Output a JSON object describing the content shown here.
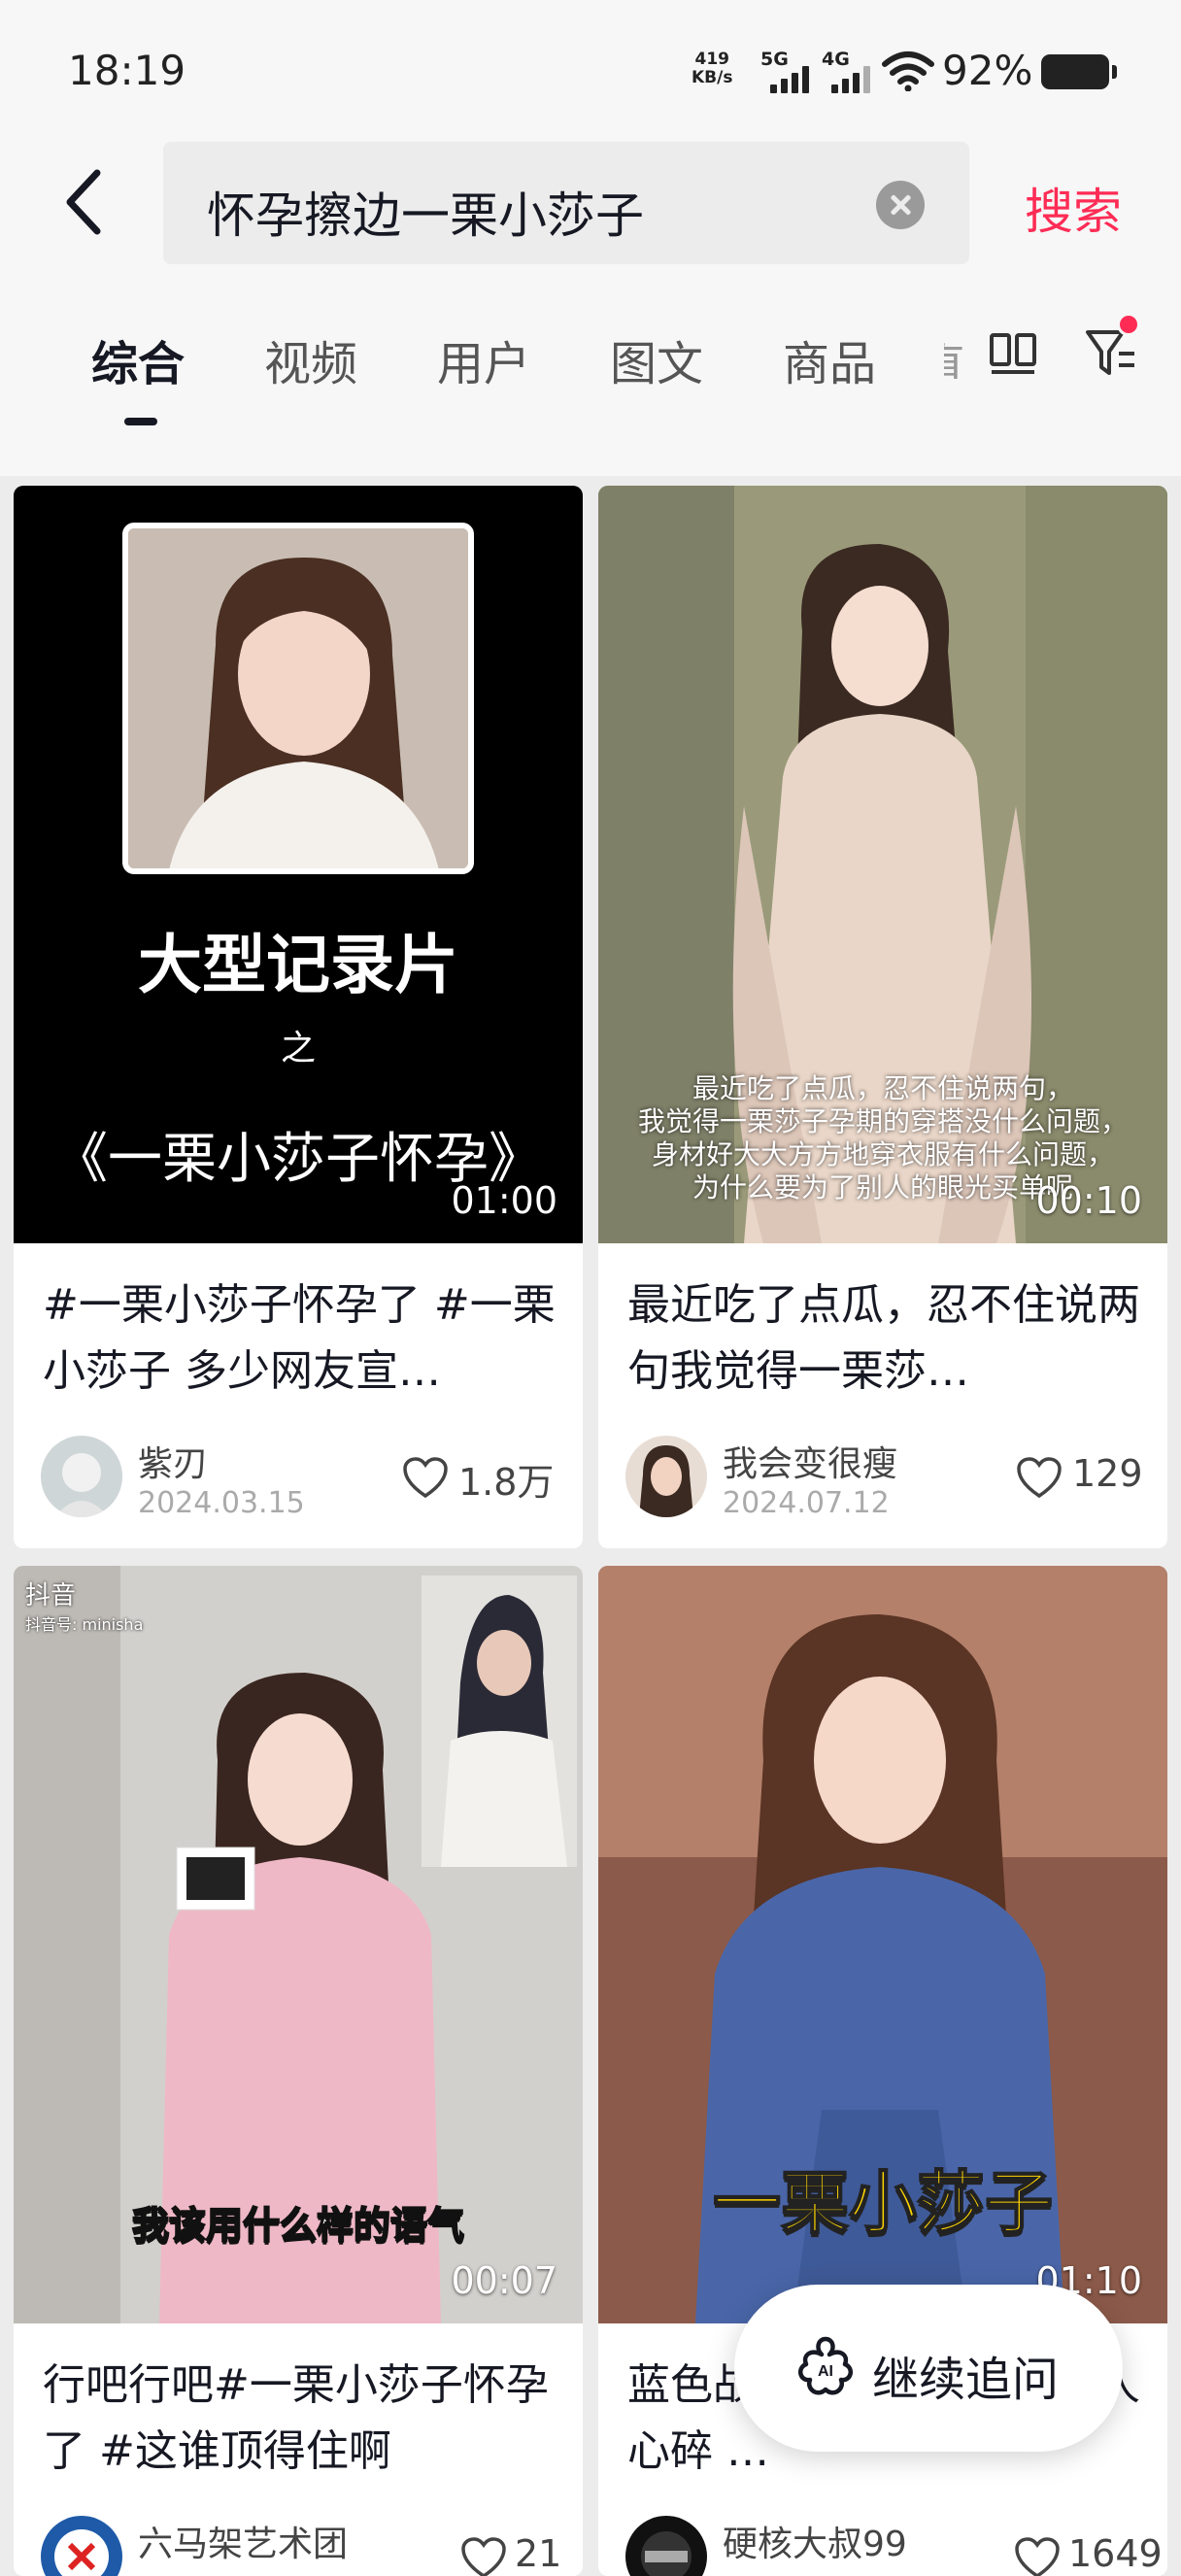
{
  "status_bar": {
    "time": "18:19",
    "net_speed_value": "419",
    "net_speed_unit": "KB/s",
    "signal1_label": "5G",
    "signal2_label": "4G",
    "battery": "92%"
  },
  "search": {
    "query": "怀孕擦边一栗小莎子",
    "button": "搜索"
  },
  "tabs": [
    {
      "label": "综合",
      "active": true
    },
    {
      "label": "视频"
    },
    {
      "label": "用户"
    },
    {
      "label": "图文"
    },
    {
      "label": "商品"
    }
  ],
  "tab_partial": "直",
  "results": [
    {
      "duration": "01:00",
      "thumb_title": "大型记录片",
      "thumb_sub": "之",
      "thumb_quote": "《一栗小莎子怀孕》",
      "title": "#一栗小莎子怀孕了 #一栗小莎子 多少网友宣…",
      "author": "紫刃",
      "date": "2024.03.15",
      "likes": "1.8万"
    },
    {
      "duration": "00:10",
      "overlay_lines": [
        "最近吃了点瓜，忍不住说两句，",
        "我觉得一栗莎子孕期的穿搭没什么问题，",
        "身材好大大方方地穿衣服有什么问题，",
        "为什么要为了别人的眼光买单呢"
      ],
      "title": "最近吃了点瓜，忍不住说两句我觉得一栗莎…",
      "author": "我会变很瘦",
      "date": "2024.07.12",
      "likes": "129"
    },
    {
      "duration": "00:07",
      "watermark": "抖音",
      "watermark_id": "抖音号: minisha",
      "caption": "我该用什么样的语气",
      "title": "行吧行吧#一栗小莎子怀孕了 #这谁顶得住啊",
      "author": "六马架艺术团",
      "likes": "21"
    },
    {
      "duration": "01:10",
      "caption": "一栗小莎子",
      "title": "蓝色战袍…朝生子让无数人心碎 …",
      "author": "硬核大叔99",
      "likes": "1649"
    }
  ],
  "fab": {
    "label": "继续追问",
    "icon": "ai-icon"
  },
  "colors": {
    "accent": "#fe2c55",
    "text": "#161823",
    "background": "#ececec"
  }
}
